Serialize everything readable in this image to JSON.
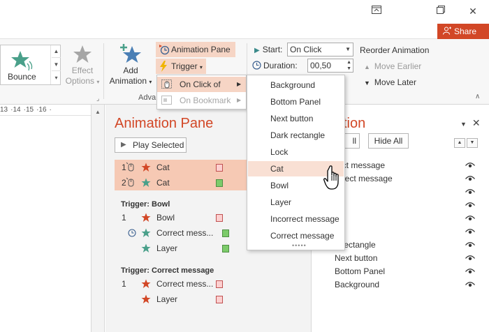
{
  "titlebar": {
    "share_label": "Share",
    "window_buttons": [
      "restore-icon",
      "maximize-icon",
      "close-icon"
    ]
  },
  "ribbon": {
    "gallery": {
      "selected": "Bounce"
    },
    "effect_options": {
      "line1": "Effect",
      "line2": "Options"
    },
    "add_animation": {
      "line1": "Add",
      "line2": "Animation"
    },
    "group_label_partial": "Adva",
    "animation_pane_btn": "Animation Pane",
    "trigger_btn": "Trigger",
    "start_label": "Start:",
    "start_value": "On Click",
    "duration_label": "Duration:",
    "duration_value": "00,50",
    "reorder_label": "Reorder Animation",
    "move_earlier": "Move Earlier",
    "move_later": "Move Later"
  },
  "ruler": {
    "ticks": [
      "13",
      "14",
      "15",
      "16"
    ]
  },
  "animation_pane": {
    "title": "Animation Pane",
    "play_selected": "Play Selected",
    "rows_top": [
      {
        "num": "1",
        "name": "Cat",
        "star_color": "#d24726",
        "bar": "red"
      },
      {
        "num": "2",
        "name": "Cat",
        "star_color": "#4aa08a",
        "bar": "green"
      }
    ],
    "trigger_bowl": {
      "heading": "Trigger: Bowl",
      "rows": [
        {
          "num": "1",
          "name": "Bowl",
          "star_color": "#d24726",
          "bar": "red"
        },
        {
          "num": "",
          "name": "Correct mess...",
          "star_color": "#4aa08a",
          "bar": "green",
          "clock": true
        },
        {
          "num": "",
          "name": "Layer",
          "star_color": "#4aa08a",
          "bar": "green"
        }
      ]
    },
    "trigger_correct": {
      "heading": "Trigger: Correct message",
      "rows": [
        {
          "num": "1",
          "name": "Correct mess...",
          "star_color": "#d24726",
          "bar": "red"
        },
        {
          "num": "",
          "name": "Layer",
          "star_color": "#d24726",
          "bar": "red"
        }
      ]
    }
  },
  "selection_pane": {
    "title_partial": "tion",
    "show_all_partial": "ll",
    "hide_all": "Hide All",
    "items": [
      {
        "label": "rect message"
      },
      {
        "label": "orrect message"
      },
      {
        "label": ""
      },
      {
        "label": ""
      },
      {
        "label": ""
      },
      {
        "label": ""
      },
      {
        "label": "k rectangle"
      },
      {
        "label": "Next button"
      },
      {
        "label": "Bottom Panel"
      },
      {
        "label": "Background"
      }
    ]
  },
  "trigger_menu": {
    "items": [
      {
        "label": "On Click of",
        "state": "active"
      },
      {
        "label": "On Bookmark",
        "state": "disabled"
      }
    ]
  },
  "object_menu": {
    "items": [
      "Background",
      "Bottom Panel",
      "Next button",
      "Dark rectangle",
      "Lock",
      "Cat",
      "Bowl",
      "Layer",
      "Incorrect message",
      "Correct message"
    ],
    "hover_index": 5
  },
  "colors": {
    "accent": "#d24726",
    "highlight": "#f6d5c5",
    "teal_star": "#4aa08a"
  }
}
